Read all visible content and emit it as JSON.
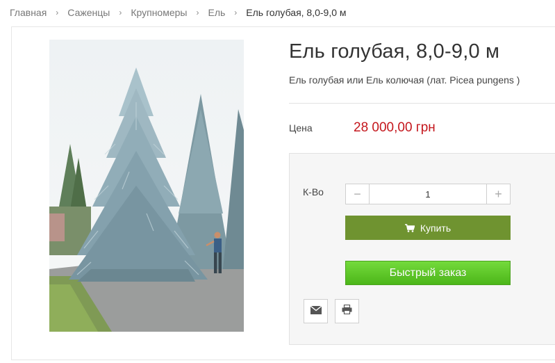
{
  "breadcrumb": {
    "items": [
      "Главная",
      "Саженцы",
      "Крупномеры",
      "Ель"
    ],
    "current": "Ель голубая, 8,0-9,0 м",
    "separator": "›"
  },
  "product": {
    "title": "Ель голубая, 8,0-9,0 м",
    "subtitle": "Ель голубая или Ель колючая (лат. Picea pungens )",
    "price_label": "Цена",
    "price": "28 000,00 грн"
  },
  "buy": {
    "qty_label": "К-Во",
    "qty_value": "1",
    "minus": "−",
    "plus": "+",
    "buy_label": "Купить",
    "quick_label": "Быстрый заказ"
  },
  "icons": {
    "cart": "shopping-cart-icon",
    "mail": "envelope-icon",
    "print": "printer-icon"
  },
  "colors": {
    "price": "#c4161c",
    "buy_button": "#6f9330",
    "quick_button": "#5cc526"
  }
}
